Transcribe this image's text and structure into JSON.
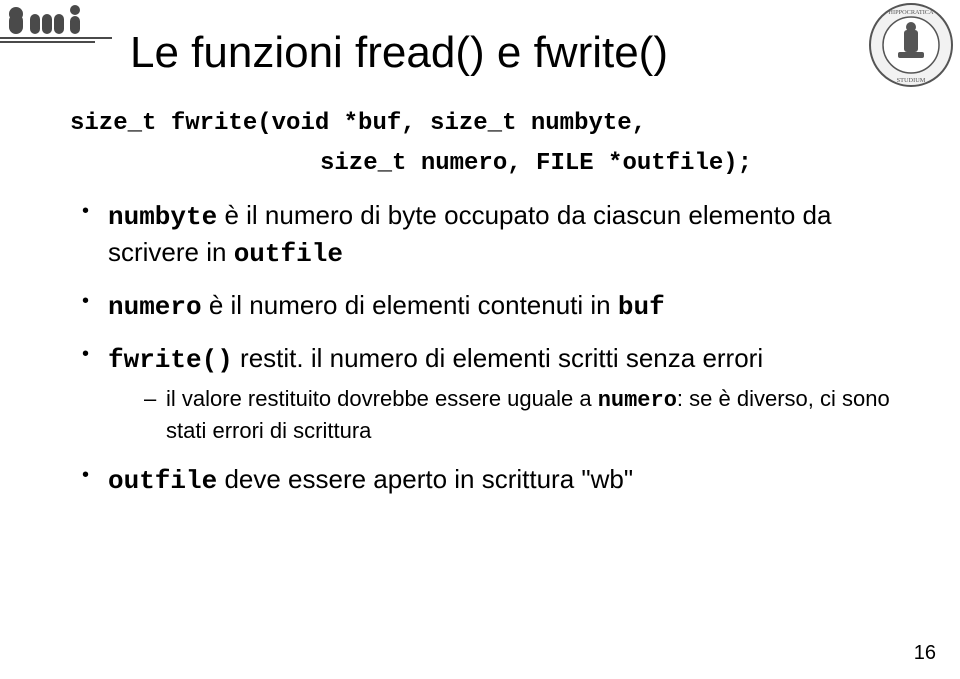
{
  "title": "Le funzioni fread() e fwrite()",
  "signature_line1": "size_t fwrite(void *buf, size_t numbyte,",
  "signature_line2": "size_t numero, FILE *outfile);",
  "bullets": {
    "b1": {
      "code1": "numbyte",
      "text1": " è il numero di byte occupato da ciascun elemento da scrivere in ",
      "code2": "outfile"
    },
    "b2": {
      "code1": "numero",
      "text1": " è il numero di elementi contenuti in ",
      "code2": "buf"
    },
    "b3": {
      "code1": "fwrite()",
      "text1": " restit. il numero di elementi scritti senza errori",
      "sub": {
        "text1": "il valore restituito dovrebbe essere uguale a ",
        "code1": "numero",
        "text2": ": se è diverso, ci sono stati errori di scrittura"
      }
    },
    "b4": {
      "code1": "outfile",
      "text1": " deve essere aperto in scrittura \"wb\""
    }
  },
  "page_number": "16"
}
